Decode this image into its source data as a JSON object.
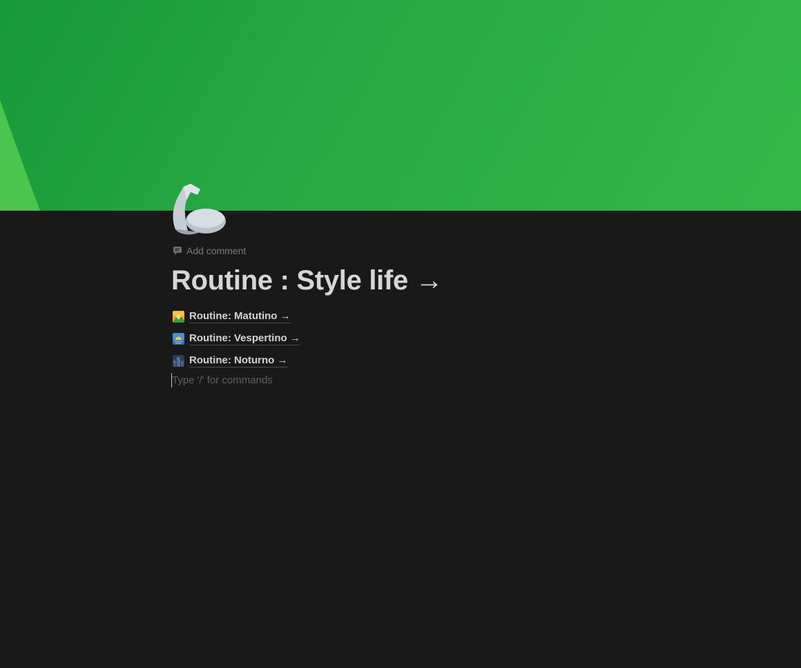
{
  "page": {
    "cover_colors": [
      "#18993a",
      "#35b849",
      "#4cc44e"
    ],
    "icon": "flexed-biceps-icon",
    "add_comment_label": "Add comment",
    "title": "Routine : Style life →",
    "links": [
      {
        "label": "Routine: Matutino →",
        "icon": "sunrise-over-mountains-icon"
      },
      {
        "label": "Routine: Vespertino →",
        "icon": "sunrise-icon"
      },
      {
        "label": "Routine: Noturno →",
        "icon": "night-city-icon"
      }
    ],
    "editor_placeholder": "Type '/' for commands"
  }
}
